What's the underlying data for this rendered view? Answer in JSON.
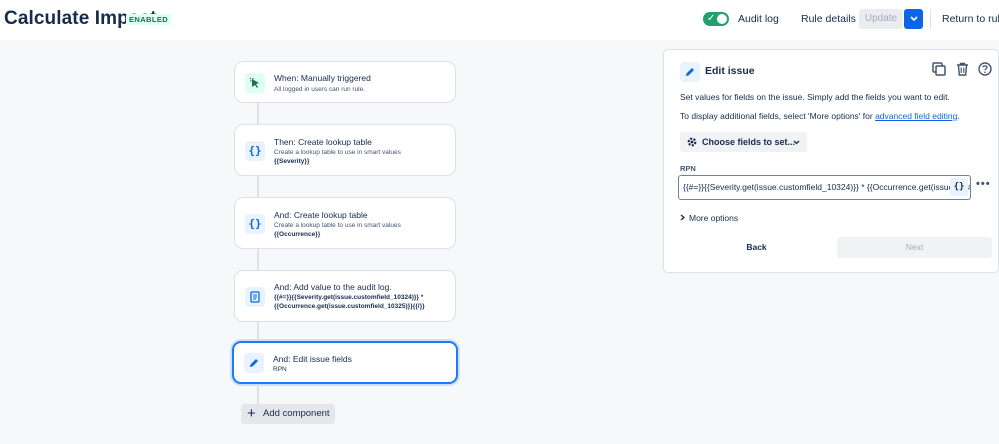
{
  "header": {
    "title": "Calculate Impact",
    "status_badge": "ENABLED",
    "audit_log": "Audit log",
    "rule_details": "Rule details",
    "update": "Update",
    "return_to_rules": "Return to rules"
  },
  "flow": {
    "cards": [
      {
        "title": "When: Manually triggered",
        "subtitle": "All logged in users can run rule.",
        "body": "",
        "icon": "cursor-click-icon"
      },
      {
        "title": "Then: Create lookup table",
        "subtitle": "Create a lookup table to use in smart values",
        "body": "{{Severity}}",
        "icon": "braces-icon"
      },
      {
        "title": "And: Create lookup table",
        "subtitle": "Create a lookup table to use in smart values",
        "body": "{{Occurrence}}",
        "icon": "braces-icon"
      },
      {
        "title": "And: Add value to the audit log.",
        "subtitle": "",
        "body": "{{#=}}{{Severity.get(issue.customfield_10324)}} * {{Occurrence.get(issue.customfield_10325)}}{{/}}",
        "icon": "document-icon"
      },
      {
        "title": "And: Edit issue fields",
        "subtitle": "",
        "body": "RPN",
        "icon": "pencil-icon"
      }
    ],
    "add_component": "Add component"
  },
  "panel": {
    "title": "Edit issue",
    "description": "Set values for fields on the issue. Simply add the fields you want to edit.",
    "more_fields_prefix": "To display additional fields, select 'More options' for ",
    "more_fields_link": "advanced field editing",
    "more_fields_suffix": ".",
    "choose_fields": "Choose fields to set...",
    "field_label": "RPN",
    "field_value": "{{#=}}{{Severity.get(issue.customfield_10324)}} * {{Occurrence.get(issue.customfield_10325)}}{{/}}",
    "smart_value_button": "{}",
    "field_more": "•••",
    "more_options": "More options",
    "back": "Back",
    "next": "Next"
  },
  "colors": {
    "accent": "#0c66e4",
    "enabled_green": "#22a06b",
    "selected_border": "#1d7afc"
  }
}
